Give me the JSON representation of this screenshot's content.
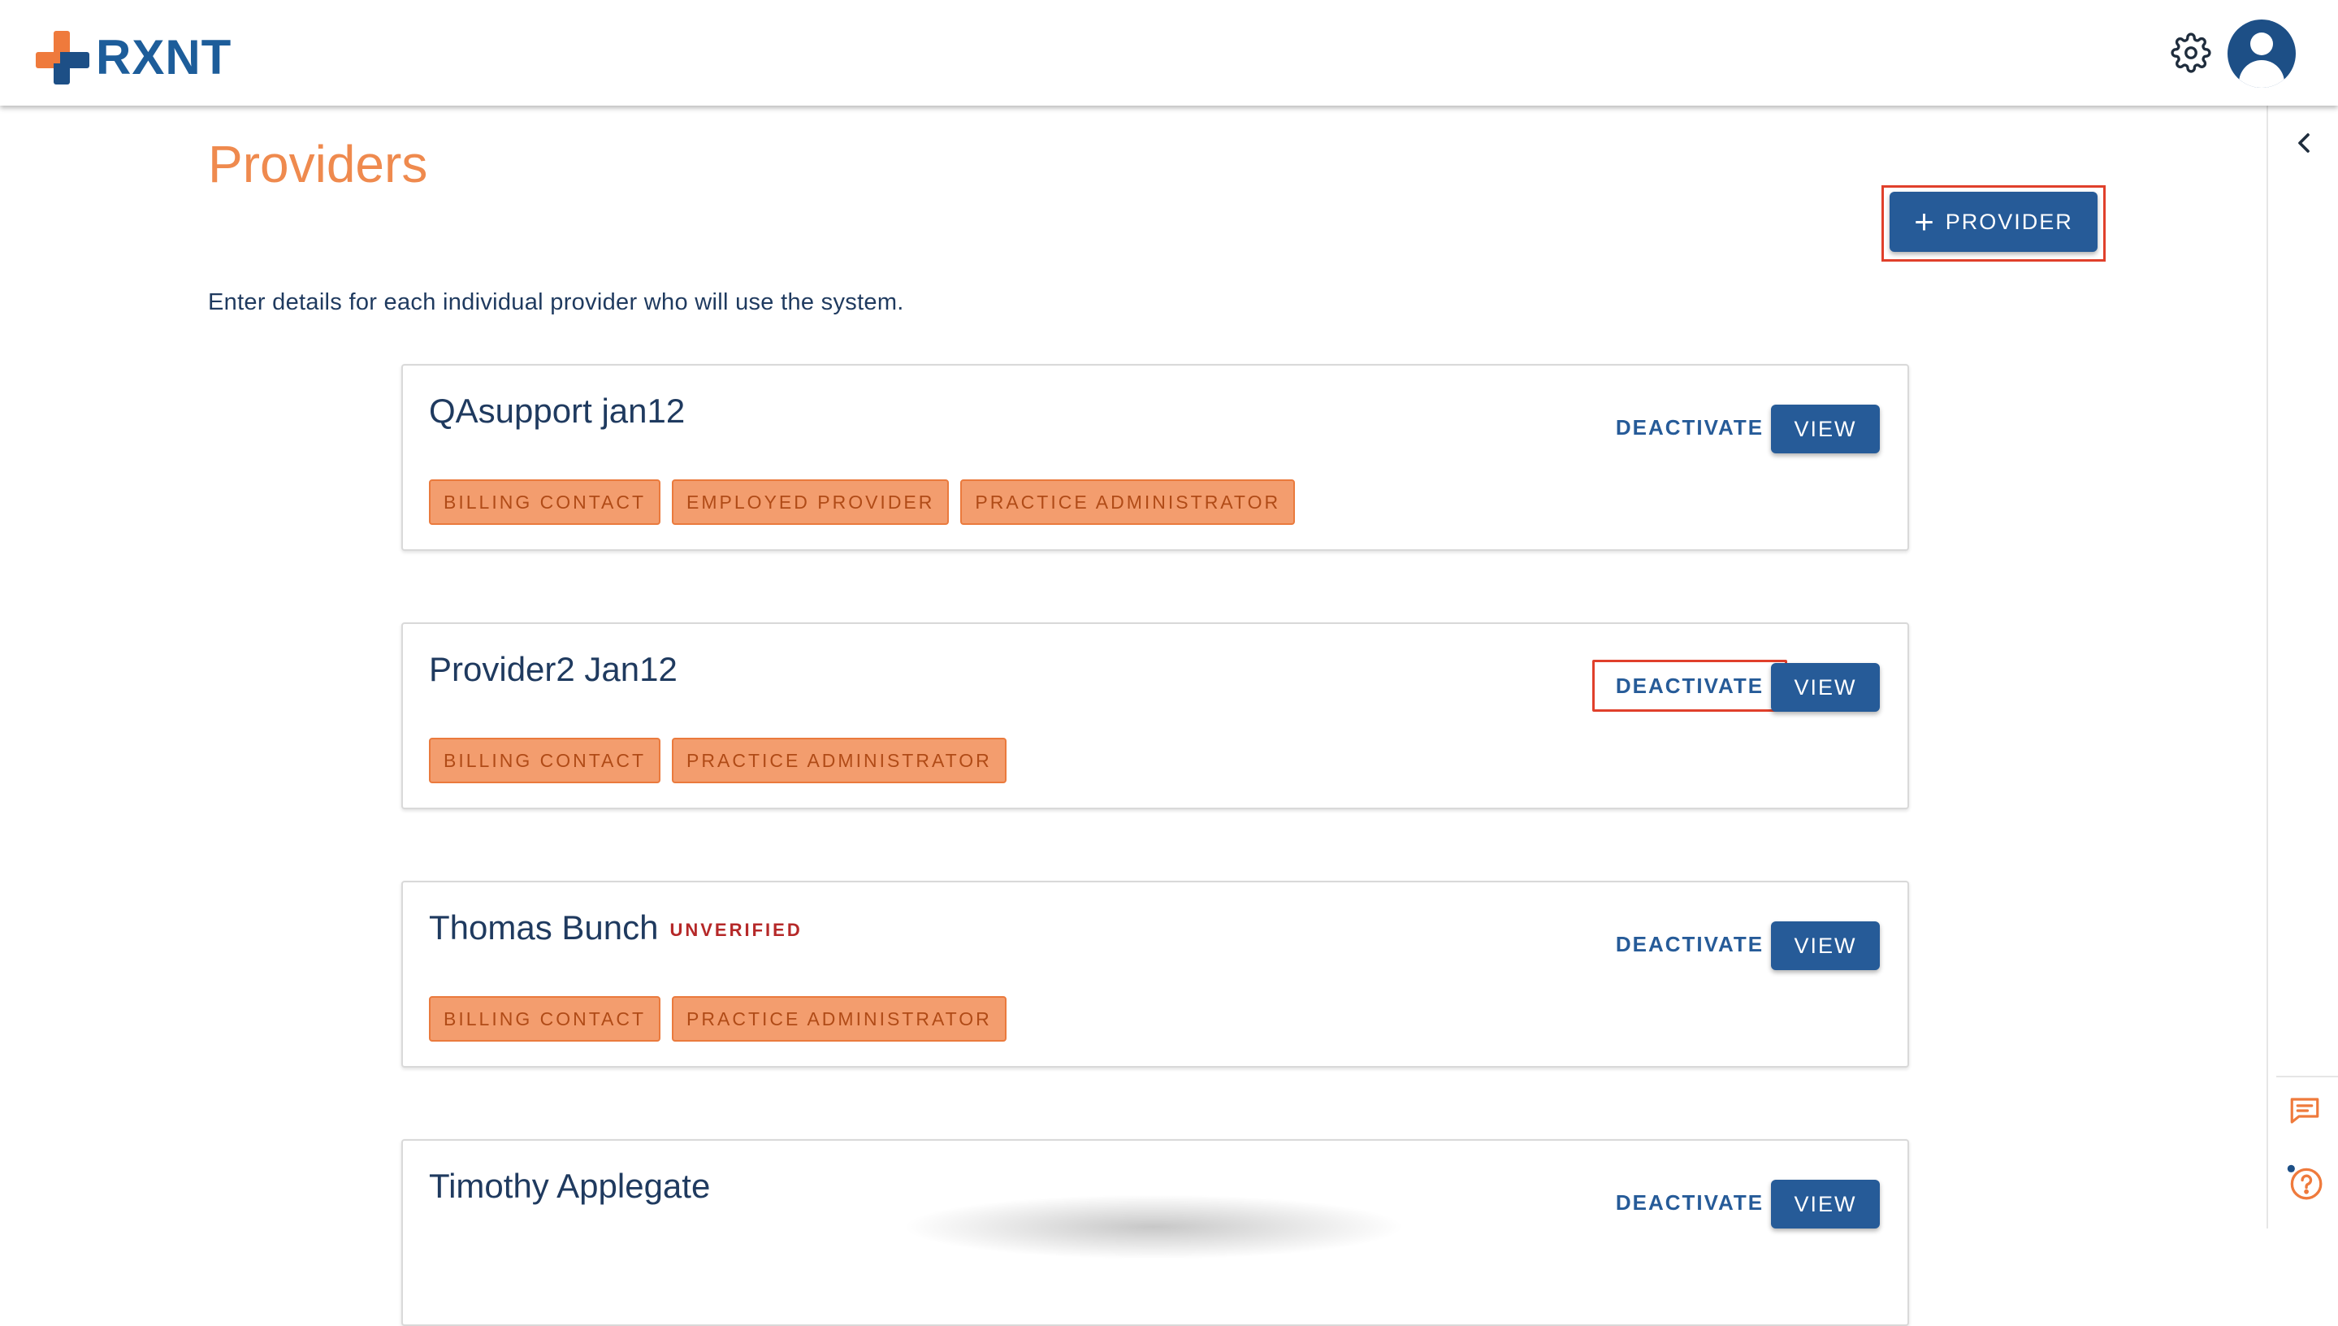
{
  "header": {
    "logo_text": "RXNT",
    "settings_icon": "gear-icon",
    "avatar_icon": "user-avatar-icon"
  },
  "page": {
    "title": "Providers",
    "add_button_label": "PROVIDER",
    "add_button_icon": "plus-icon",
    "description": "Enter details for each individual provider who will use the system."
  },
  "providers": [
    {
      "name": "QAsupport jan12",
      "status": "",
      "deactivate_label": "DEACTIVATE",
      "view_label": "VIEW",
      "tags": [
        "BILLING CONTACT",
        "EMPLOYED PROVIDER",
        "PRACTICE ADMINISTRATOR"
      ]
    },
    {
      "name": "Provider2 Jan12",
      "status": "",
      "deactivate_label": "DEACTIVATE",
      "view_label": "VIEW",
      "tags": [
        "BILLING CONTACT",
        "PRACTICE ADMINISTRATOR"
      ]
    },
    {
      "name": "Thomas Bunch",
      "status": "UNVERIFIED",
      "deactivate_label": "DEACTIVATE",
      "view_label": "VIEW",
      "tags": [
        "BILLING CONTACT",
        "PRACTICE ADMINISTRATOR"
      ]
    },
    {
      "name": "Timothy Applegate",
      "status": "",
      "deactivate_label": "DEACTIVATE",
      "view_label": "VIEW",
      "tags": []
    }
  ],
  "rail": {
    "collapse_icon": "chevron-left-icon",
    "chat_icon": "chat-icon",
    "help_icon": "help-icon"
  },
  "colors": {
    "brand_blue": "#265b98",
    "brand_orange": "#ef8a4e",
    "tag_fill": "#f39d6e",
    "unverified_red": "#b52828",
    "highlight_red": "#e0402b"
  }
}
